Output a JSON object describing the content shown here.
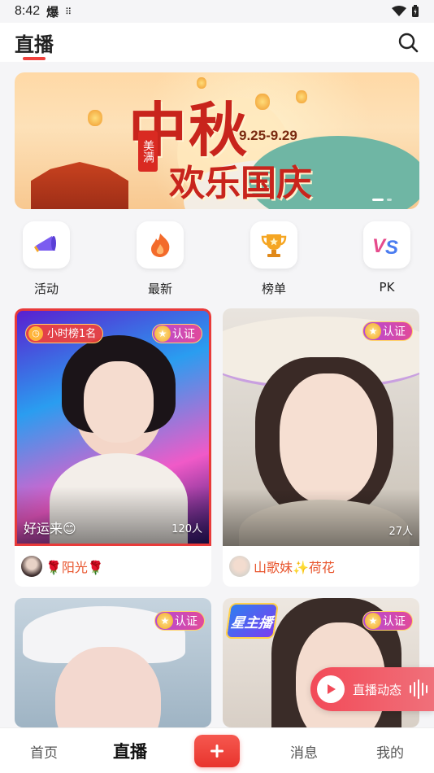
{
  "status_bar": {
    "time": "8:42",
    "app_glyph": "爆",
    "grid_glyph": "⠿"
  },
  "header": {
    "title": "直播"
  },
  "banner": {
    "big_text": "中秋",
    "sub_text": "欢乐国庆",
    "date": "9.25-9.29",
    "stamp": "美满"
  },
  "quick_nav": [
    {
      "label": "活动",
      "icon": "megaphone-icon"
    },
    {
      "label": "最新",
      "icon": "flame-icon"
    },
    {
      "label": "榜单",
      "icon": "trophy-icon"
    },
    {
      "label": "PK",
      "icon": "versus-icon"
    }
  ],
  "cards": [
    {
      "rank_badge": "小时榜1名",
      "verified": "认证",
      "caption": "好运来😊",
      "viewers": "120人",
      "name": "🌹阳光🌹"
    },
    {
      "verified": "认证",
      "viewers": "27人",
      "name": "山歌妹✨荷花"
    },
    {
      "verified": "认证"
    },
    {
      "verified": "认证",
      "star_host": "星主播"
    }
  ],
  "live_pill": {
    "label": "直播动态"
  },
  "tabbar": {
    "home": "首页",
    "live": "直播",
    "messages": "消息",
    "mine": "我的"
  },
  "colors": {
    "accent": "#f0413d",
    "name_orange": "#e8542c",
    "verified_purple": "#b44ad6"
  }
}
